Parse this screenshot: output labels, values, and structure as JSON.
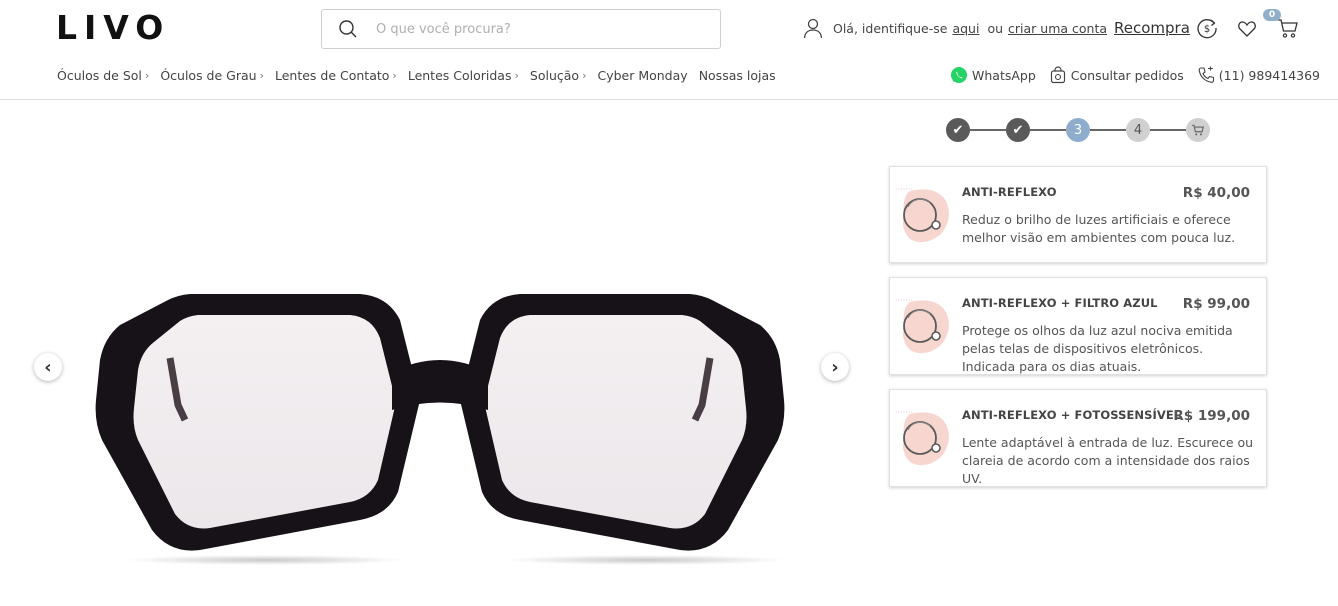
{
  "header": {
    "logo": "LIVO",
    "search_placeholder": "O que você procura?",
    "greeting": "Olá, identifique-se",
    "login_link": "aqui",
    "or_text": "ou",
    "signup_link": "criar uma conta",
    "rebuy": "Recompra",
    "cart_count": "0"
  },
  "nav": {
    "items": [
      {
        "label": "Óculos de Sol",
        "chevron": true
      },
      {
        "label": "Óculos de Grau",
        "chevron": true
      },
      {
        "label": "Lentes de Contato",
        "chevron": true
      },
      {
        "label": "Lentes Coloridas",
        "chevron": true
      },
      {
        "label": "Solução",
        "chevron": true
      },
      {
        "label": "Cyber Monday",
        "chevron": false
      },
      {
        "label": "Nossas lojas",
        "chevron": false
      }
    ],
    "whatsapp": "WhatsApp",
    "orders": "Consultar pedidos",
    "phone": "(11) 989414369"
  },
  "steps": {
    "labels": [
      "✔",
      "✔",
      "3",
      "4",
      "cart"
    ],
    "current": 3
  },
  "options": [
    {
      "title": "ANTI-REFLEXO",
      "price": "R$ 40,00",
      "desc": "Reduz o brilho de luzes artificiais e oferece melhor visão em ambientes com pouca luz."
    },
    {
      "title": "ANTI-REFLEXO + FILTRO AZUL",
      "price": "R$ 99,00",
      "desc": "Protege os olhos da luz azul nociva emitida pelas telas de dispositivos eletrônicos. Indicada para os dias atuais."
    },
    {
      "title": "ANTI-REFLEXO + FOTOSSENSÍVEL",
      "price": "R$ 199,00",
      "desc": "Lente adaptável à entrada de luz. Escurece ou clareia de acordo com a intensidade dos raios UV."
    }
  ],
  "gallery": {
    "prev_arrow": "‹",
    "next_arrow": "›"
  },
  "colors": {
    "accent": "#8eaccb",
    "step_done": "#5a5a5a",
    "whatsapp": "#25d366",
    "frame": "#171217"
  }
}
